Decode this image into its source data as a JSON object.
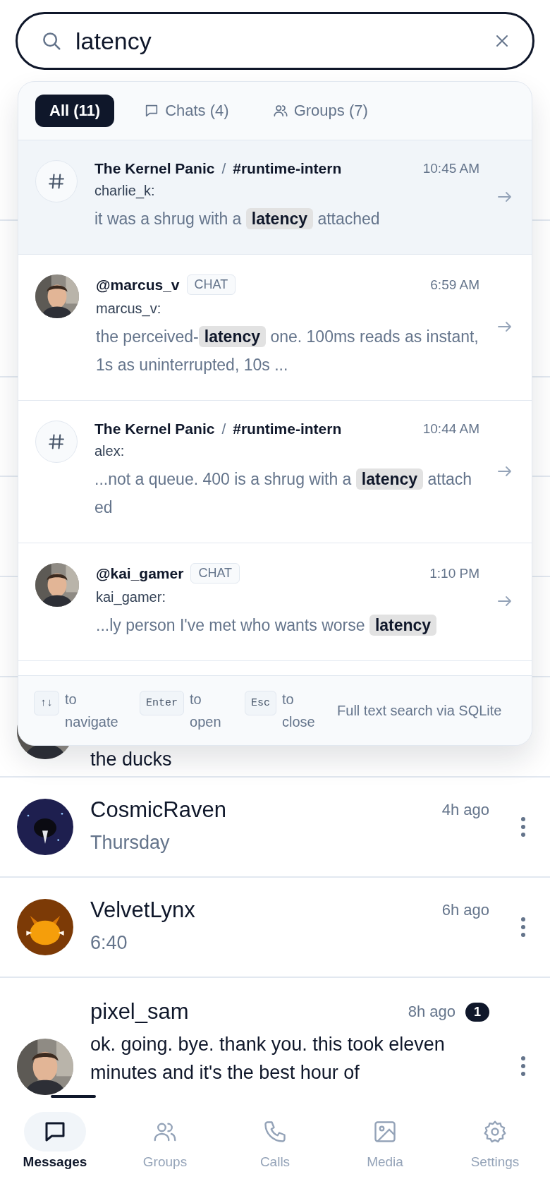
{
  "search": {
    "value": "latency"
  },
  "filter_tabs": [
    {
      "label": "All (11)",
      "selected": true
    },
    {
      "label": "Chats (4)",
      "selected": false
    },
    {
      "label": "Groups (7)",
      "selected": false
    }
  ],
  "results": [
    {
      "kind": "channel",
      "group": "The Kernel Panic",
      "separator": "/",
      "channel": "#runtime-intern",
      "time": "10:45 AM",
      "sender": "charlie_k:",
      "snippet": "it was a shrug with a **latency** attached",
      "selected": true
    },
    {
      "kind": "chat",
      "title": "@marcus_v",
      "badge": "CHAT",
      "time": "6:59 AM",
      "sender": "marcus_v:",
      "snippet": "the perceived-**latency** one. 100ms reads as instant, 1s as uninterrupted, 10s ...",
      "selected": false
    },
    {
      "kind": "channel",
      "group": "The Kernel Panic",
      "separator": "/",
      "channel": "#runtime-intern",
      "time": "10:44 AM",
      "sender": "alex:",
      "snippet": "...not a queue. 400 is a shrug with a **latency** attached",
      "selected": false
    },
    {
      "kind": "chat",
      "title": "@kai_gamer",
      "badge": "CHAT",
      "time": "1:10 PM",
      "sender": "kai_gamer:",
      "snippet": "...ly person I've met who wants worse **latency**",
      "selected": false
    }
  ],
  "hints": [
    {
      "key": "↑↓",
      "text": "to navigate"
    },
    {
      "key": "Enter",
      "text": "to open"
    },
    {
      "key": "Esc",
      "text": "to close"
    }
  ],
  "hint_note": "Full text search via SQLite",
  "conversations": [
    {
      "kind": "partial",
      "preview": "the ducks"
    },
    {
      "kind": "full",
      "name": "CosmicRaven",
      "time": "4h ago",
      "preview": "Thursday",
      "unread": false
    },
    {
      "kind": "full",
      "name": "VelvetLynx",
      "time": "6h ago",
      "preview": "6:40",
      "unread": false
    },
    {
      "kind": "full",
      "name": "pixel_sam",
      "time": "8h ago",
      "unread_count": "1",
      "preview": "ok. going. bye. thank you. this took eleven minutes and it's the best hour of",
      "unread": true
    }
  ],
  "nav": [
    {
      "label": "Messages",
      "selected": true
    },
    {
      "label": "Groups",
      "selected": false
    },
    {
      "label": "Calls",
      "selected": false
    },
    {
      "label": "Media",
      "selected": false
    },
    {
      "label": "Settings",
      "selected": false
    }
  ]
}
